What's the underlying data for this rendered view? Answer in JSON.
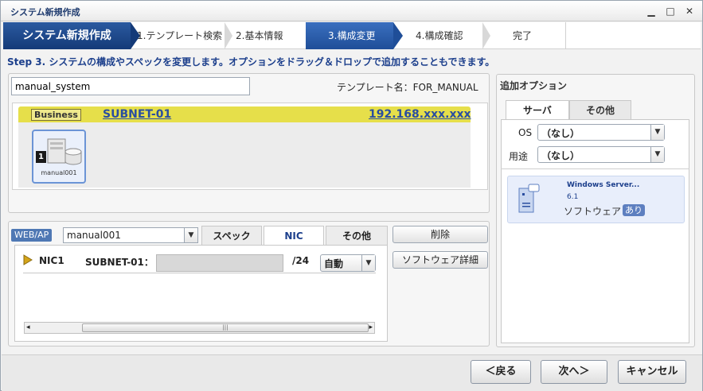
{
  "window": {
    "title": "システム新規作成",
    "minimize": "▁",
    "maximize": "□",
    "close": "✕"
  },
  "wizard": {
    "main_label": "システム新規作成",
    "steps": [
      {
        "label": "1.テンプレート検索"
      },
      {
        "label": "2.基本情報"
      },
      {
        "label": "3.構成変更"
      },
      {
        "label": "4.構成確認"
      },
      {
        "label": "完了"
      }
    ]
  },
  "instruction": "Step 3. システムの構成やスペックを変更します。オプションをドラッグ＆ドロップで追加することもできます。",
  "system": {
    "name_value": "manual_system",
    "template_label": "テンプレート名：FOR_MANUAL"
  },
  "canvas": {
    "zone_tag": "Business",
    "subnet_name": "SUBNET-01",
    "subnet_ip": "192.168.xxx.xxx",
    "node_number": "1",
    "node_label": "manual001"
  },
  "server_detail": {
    "role_tag": "WEB/AP",
    "server_select": "manual001",
    "tabs": [
      {
        "label": "スペック"
      },
      {
        "label": "NIC"
      },
      {
        "label": "その他"
      }
    ],
    "nic": {
      "name": "NIC1",
      "subnet_label": "SUBNET-01：",
      "mask": "/24",
      "mode": "自動"
    },
    "scroll_thumb": "|||",
    "scroll_left": "◂",
    "scroll_right": "▸",
    "delete_button": "削除",
    "software_detail_button": "ソフトウェア詳細"
  },
  "options": {
    "title": "追加オプション",
    "tabs": [
      {
        "label": "サーバ"
      },
      {
        "label": "その他"
      }
    ],
    "os_label": "OS",
    "os_value": "（なし）",
    "usage_label": "用途",
    "usage_value": "（なし）",
    "software": {
      "name": "Windows Server...",
      "version": "6.1",
      "type": "ソフトウェア",
      "badge": "あり"
    }
  },
  "footer": {
    "back": "＜戻る",
    "next": "次へ＞",
    "cancel": "キャンセル"
  },
  "colors": {
    "accent": "#1f4e98",
    "subnet_bar": "#e6df4a",
    "link": "#2a4ea0"
  }
}
